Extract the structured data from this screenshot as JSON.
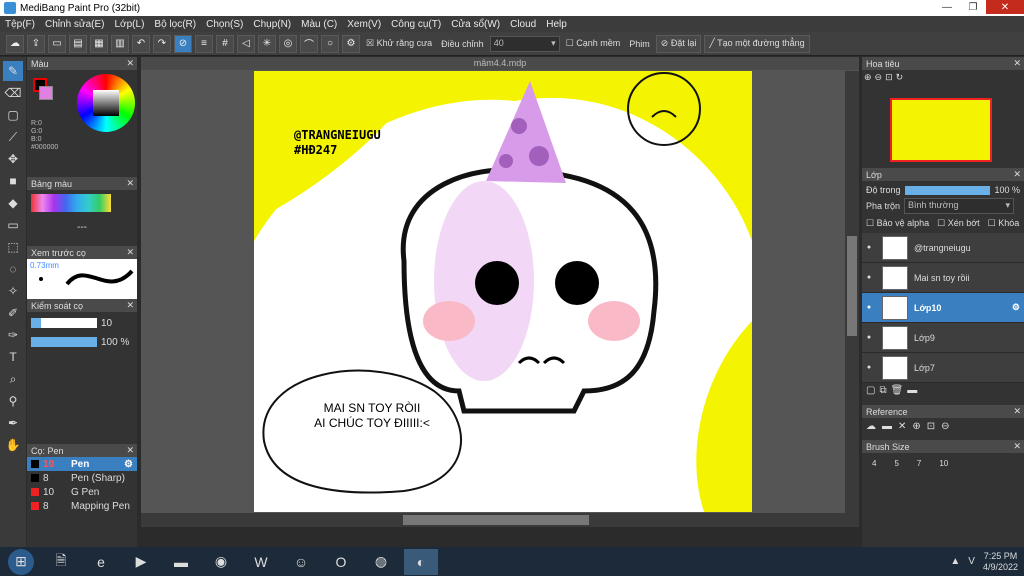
{
  "window": {
    "title": "MediBang Paint Pro (32bit)"
  },
  "menu": [
    "Tệp(F)",
    "Chỉnh sửa(E)",
    "Lớp(L)",
    "Bộ lọc(R)",
    "Chọn(S)",
    "Chụp(N)",
    "Màu (C)",
    "Xem(V)",
    "Công cụ(T)",
    "Cửa sổ(W)",
    "Cloud",
    "Help"
  ],
  "toolbar": {
    "antialias": "Khử răng cưa",
    "adjust_label": "Điều chỉnh",
    "adjust_value": "40",
    "edge": "Cạnh mềm",
    "brush": "Phim",
    "reset": "Đặt lại",
    "line": "Tạo một đường thẳng"
  },
  "panels": {
    "color": {
      "title": "Màu",
      "r": "R:0",
      "g": "G:0",
      "b": "B:0",
      "hex": "#000000"
    },
    "palette": {
      "title": "Bảng màu",
      "dash": "---"
    },
    "preview": {
      "title": "Xem trước cọ",
      "size": "0.73mm"
    },
    "brush_ctrl": {
      "title": "Kiểm soát cọ",
      "size": "10",
      "opacity": "100 %"
    },
    "brush_list": {
      "title": "Cọ: Pen",
      "items": [
        {
          "size": "10",
          "name": "Pen"
        },
        {
          "size": "8",
          "name": "Pen (Sharp)"
        },
        {
          "size": "10",
          "name": "G Pen"
        },
        {
          "size": "8",
          "name": "Mapping Pen"
        }
      ]
    },
    "navigator": {
      "title": "Hoa tiêu"
    },
    "layer": {
      "title": "Lớp",
      "opacity_label": "Độ trong",
      "opacity_value": "100 %",
      "blend_label": "Pha trộn",
      "blend_value": "Bình thường",
      "protect": "Bảo vệ alpha",
      "clip": "Xén bớt",
      "lock": "Khóa",
      "items": [
        {
          "name": "@trangneiugu"
        },
        {
          "name": "Mai sn toy rồii"
        },
        {
          "name": "Lớp10"
        },
        {
          "name": "Lớp9"
        },
        {
          "name": "Lớp7"
        }
      ]
    },
    "reference": {
      "title": "Reference"
    },
    "brushsize": {
      "title": "Brush Size",
      "sizes": [
        "4",
        "5",
        "7",
        "10"
      ]
    }
  },
  "document": {
    "tab": "mâm4.4.mdp",
    "watermark1": "@TRANGNEIUGU",
    "watermark2": "#HĐ247",
    "bubble1": "MAI SN TOY RÒII",
    "bubble2": "AI CHÚC TOY ĐIIIII:<"
  },
  "taskbar": {
    "time": "7:25 PM",
    "date": "4/9/2022",
    "lang": "V"
  }
}
